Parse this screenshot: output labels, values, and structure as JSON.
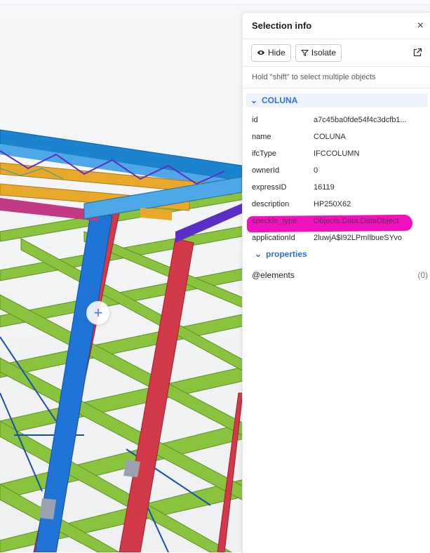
{
  "panel": {
    "title": "Selection info",
    "close_glyph": "×",
    "toolbar": {
      "hide_label": "Hide",
      "isolate_label": "Isolate"
    },
    "hint": "Hold \"shift\" to select multiple objects",
    "group": {
      "name": "COLUNA",
      "rows": [
        {
          "key": "id",
          "value": "a7c45ba0fde54f4c3dcfb1..."
        },
        {
          "key": "name",
          "value": "COLUNA"
        },
        {
          "key": "ifcType",
          "value": "IFCCOLUMN"
        },
        {
          "key": "ownerId",
          "value": "0"
        },
        {
          "key": "expressID",
          "value": "16119"
        },
        {
          "key": "description",
          "value": "HP250X62"
        },
        {
          "key": "speckle_type",
          "value": "Objects.Data.DataObject"
        },
        {
          "key": "applicationId",
          "value": "2luwjA$I92LPmIlbueSYvo"
        }
      ],
      "properties_label": "properties",
      "elements_label": "@elements",
      "elements_count": "(0)"
    }
  },
  "viewport": {
    "add_glyph": "+"
  },
  "colors": {
    "accent": "#2f6fdc",
    "highlight": "#f012be",
    "beam_green": "#8ac43f",
    "column_red": "#d23a4a",
    "column_blue": "#1f74d6",
    "beam_yellow": "#e8a92a",
    "beam_purple": "#5a2fc8"
  },
  "icons": [
    "eye-icon",
    "filter-icon",
    "external-link-icon",
    "close-icon",
    "chevron-down-icon",
    "plus-icon"
  ]
}
